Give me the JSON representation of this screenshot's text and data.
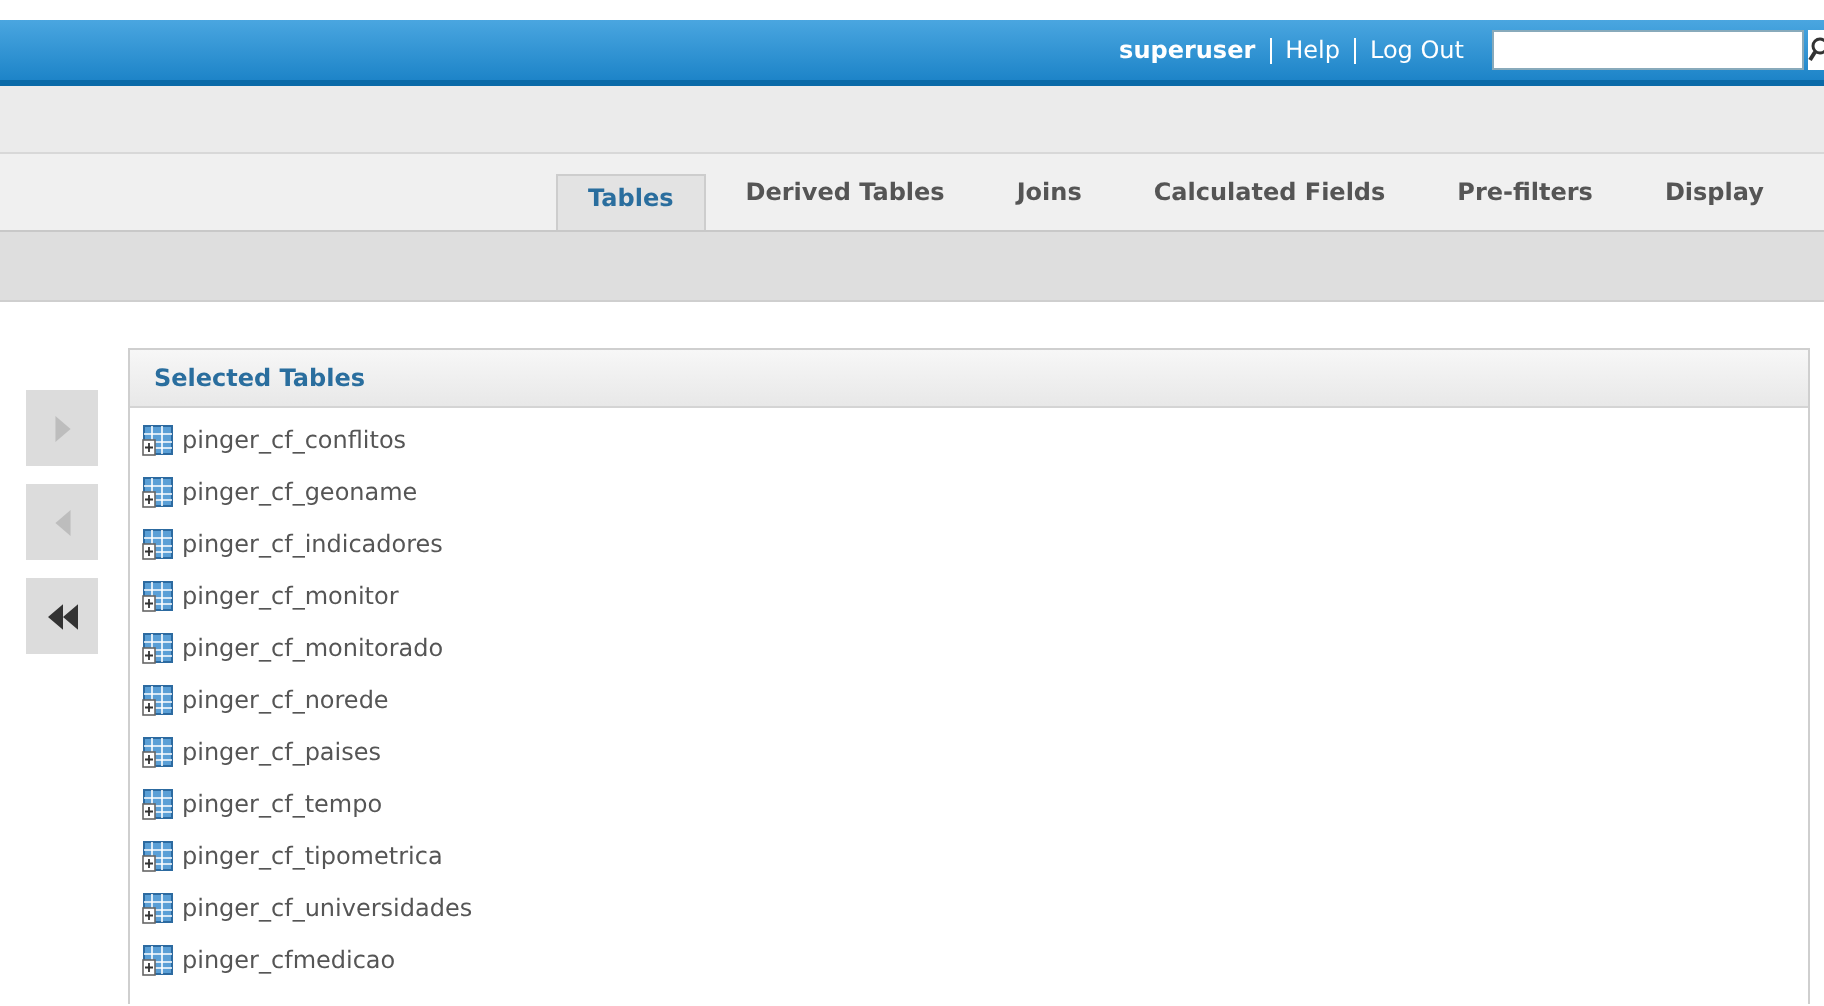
{
  "header": {
    "user": "superuser",
    "links": [
      "Help",
      "Log Out"
    ]
  },
  "tabs": [
    {
      "label": "Tables",
      "selected": true
    },
    {
      "label": "Derived Tables",
      "selected": false
    },
    {
      "label": "Joins",
      "selected": false
    },
    {
      "label": "Calculated Fields",
      "selected": false
    },
    {
      "label": "Pre-filters",
      "selected": false
    },
    {
      "label": "Display",
      "selected": false
    }
  ],
  "move_buttons": [
    {
      "kind": "add",
      "disabled": true
    },
    {
      "kind": "remove",
      "disabled": true
    },
    {
      "kind": "remove_all",
      "disabled": false
    }
  ],
  "selected_tables": {
    "title": "Selected Tables",
    "items": [
      "pinger_cf_conflitos",
      "pinger_cf_geoname",
      "pinger_cf_indicadores",
      "pinger_cf_monitor",
      "pinger_cf_monitorado",
      "pinger_cf_norede",
      "pinger_cf_paises",
      "pinger_cf_tempo",
      "pinger_cf_tipometrica",
      "pinger_cf_universidades",
      "pinger_cfmedicao"
    ]
  }
}
